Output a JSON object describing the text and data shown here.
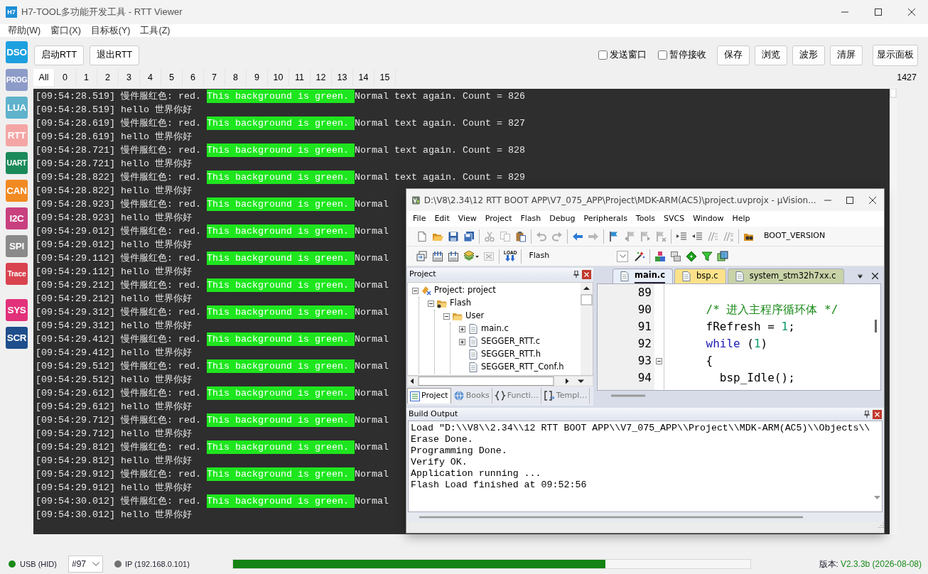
{
  "window": {
    "app_icon_text": "H7",
    "title": "H7-TOOL多功能开发工具 - RTT Viewer"
  },
  "menu": [
    "帮助(W)",
    "窗口(X)",
    "目标板(Y)",
    "工具(Z)"
  ],
  "sidebar": {
    "groups": [
      {
        "items": [
          {
            "label": "DSO",
            "color": "#1ea0e0"
          },
          {
            "label": "PROG",
            "color": "#8d9bc8"
          },
          {
            "label": "LUA",
            "color": "#5fb2cc"
          },
          {
            "label": "RTT",
            "color": "#f4a5a5"
          },
          {
            "label": "UART",
            "color": "#1b8a5a"
          },
          {
            "label": "CAN",
            "color": "#f28a22"
          },
          {
            "label": "I2C",
            "color": "#c8407f"
          },
          {
            "label": "SPI",
            "color": "#8a8a8a"
          },
          {
            "label": "Trace",
            "color": "#d9434f"
          }
        ]
      },
      {
        "items": [
          {
            "label": "SYS",
            "color": "#e2317b"
          },
          {
            "label": "SCR",
            "color": "#1f4e8c"
          }
        ]
      }
    ]
  },
  "toolbar": {
    "left_buttons": [
      "启动RTT",
      "退出RTT"
    ],
    "checkboxes": [
      {
        "label": "发送窗口",
        "checked": false
      },
      {
        "label": "暂停接收",
        "checked": false
      }
    ],
    "right_buttons": [
      "保存",
      "浏览",
      "波形",
      "清屏",
      "显示面板"
    ]
  },
  "channel_tabs": {
    "tabs": [
      {
        "label": "All",
        "selected": true
      },
      {
        "label": "0",
        "selected": false
      },
      {
        "label": "1",
        "selected": false
      },
      {
        "label": "2",
        "selected": false
      },
      {
        "label": "3",
        "selected": false
      },
      {
        "label": "4",
        "selected": false
      },
      {
        "label": "5",
        "selected": false
      },
      {
        "label": "6",
        "selected": false
      },
      {
        "label": "7",
        "selected": false
      },
      {
        "label": "8",
        "selected": false
      },
      {
        "label": "9",
        "selected": false
      },
      {
        "label": "10",
        "selected": false
      },
      {
        "label": "11",
        "selected": false
      },
      {
        "label": "12",
        "selected": false
      },
      {
        "label": "13",
        "selected": false
      },
      {
        "label": "14",
        "selected": false
      },
      {
        "label": "15",
        "selected": false
      }
    ],
    "count": "1427"
  },
  "terminal": {
    "lines": [
      {
        "kind": "color",
        "time": "[09:54:28.519]",
        "text": "慢件服红色: red.",
        "highlight": "This background is green.",
        "rest": "Normal text again. Count = 826"
      },
      {
        "kind": "plain",
        "time": "[09:54:28.519]",
        "text": "hello 世界你好"
      },
      {
        "kind": "color",
        "time": "[09:54:28.619]",
        "text": "慢件服红色: red.",
        "highlight": "This background is green.",
        "rest": "Normal text again. Count = 827"
      },
      {
        "kind": "plain",
        "time": "[09:54:28.619]",
        "text": "hello 世界你好"
      },
      {
        "kind": "color",
        "time": "[09:54:28.721]",
        "text": "慢件服红色: red.",
        "highlight": "This background is green.",
        "rest": "Normal text again. Count = 828"
      },
      {
        "kind": "plain",
        "time": "[09:54:28.721]",
        "text": "hello 世界你好"
      },
      {
        "kind": "color",
        "time": "[09:54:28.822]",
        "text": "慢件服红色: red.",
        "highlight": "This background is green.",
        "rest": "Normal text again. Count = 829"
      },
      {
        "kind": "plain",
        "time": "[09:54:28.822]",
        "text": "hello 世界你好"
      },
      {
        "kind": "color",
        "time": "[09:54:28.923]",
        "text": "慢件服红色: red.",
        "highlight": "This background is green.",
        "rest": "Normal"
      },
      {
        "kind": "plain",
        "time": "[09:54:28.923]",
        "text": "hello 世界你好"
      },
      {
        "kind": "color",
        "time": "[09:54:29.012]",
        "text": "慢件服红色: red.",
        "highlight": "This background is green.",
        "rest": "Normal"
      },
      {
        "kind": "plain",
        "time": "[09:54:29.012]",
        "text": "hello 世界你好"
      },
      {
        "kind": "color",
        "time": "[09:54:29.112]",
        "text": "慢件服红色: red.",
        "highlight": "This background is green.",
        "rest": "Normal"
      },
      {
        "kind": "plain",
        "time": "[09:54:29.112]",
        "text": "hello 世界你好"
      },
      {
        "kind": "color",
        "time": "[09:54:29.212]",
        "text": "慢件服红色: red.",
        "highlight": "This background is green.",
        "rest": "Normal"
      },
      {
        "kind": "plain",
        "time": "[09:54:29.212]",
        "text": "hello 世界你好"
      },
      {
        "kind": "color",
        "time": "[09:54:29.312]",
        "text": "慢件服红色: red.",
        "highlight": "This background is green.",
        "rest": "Normal"
      },
      {
        "kind": "plain",
        "time": "[09:54:29.312]",
        "text": "hello 世界你好"
      },
      {
        "kind": "color",
        "time": "[09:54:29.412]",
        "text": "慢件服红色: red.",
        "highlight": "This background is green.",
        "rest": "Normal"
      },
      {
        "kind": "plain",
        "time": "[09:54:29.412]",
        "text": "hello 世界你好"
      },
      {
        "kind": "color",
        "time": "[09:54:29.512]",
        "text": "慢件服红色: red.",
        "highlight": "This background is green.",
        "rest": "Normal"
      },
      {
        "kind": "plain",
        "time": "[09:54:29.512]",
        "text": "hello 世界你好"
      },
      {
        "kind": "color",
        "time": "[09:54:29.612]",
        "text": "慢件服红色: red.",
        "highlight": "This background is green.",
        "rest": "Normal"
      },
      {
        "kind": "plain",
        "time": "[09:54:29.612]",
        "text": "hello 世界你好"
      },
      {
        "kind": "color",
        "time": "[09:54:29.712]",
        "text": "慢件服红色: red.",
        "highlight": "This background is green.",
        "rest": "Normal"
      },
      {
        "kind": "plain",
        "time": "[09:54:29.712]",
        "text": "hello 世界你好"
      },
      {
        "kind": "color",
        "time": "[09:54:29.812]",
        "text": "慢件服红色: red.",
        "highlight": "This background is green.",
        "rest": "Normal"
      },
      {
        "kind": "plain",
        "time": "[09:54:29.812]",
        "text": "hello 世界你好"
      },
      {
        "kind": "color",
        "time": "[09:54:29.912]",
        "text": "慢件服红色: red.",
        "highlight": "This background is green.",
        "rest": "Normal"
      },
      {
        "kind": "plain",
        "time": "[09:54:29.912]",
        "text": "hello 世界你好"
      },
      {
        "kind": "color",
        "time": "[09:54:30.012]",
        "text": "慢件服红色: red.",
        "highlight": "This background is green.",
        "rest": "Normal"
      },
      {
        "kind": "plain",
        "time": "[09:54:30.012]",
        "text": "hello 世界你好"
      }
    ]
  },
  "status_bar": {
    "usb": {
      "label": "USB (HID)",
      "color": "#1a8a1a"
    },
    "device": "#97",
    "ip": {
      "label": "IP (192.168.0.101)",
      "color": "#707070"
    },
    "progress": {
      "level": 0.72
    },
    "version_label": "版本:",
    "version": "V2.3.3b (2026-08-08)"
  },
  "uvision": {
    "title": "D:\\V8\\2.34\\12 RTT BOOT APP\\V7_075_APP\\Project\\MDK-ARM(AC5)\\project.uvprojx - µVision...",
    "menu": [
      "File",
      "Edit",
      "View",
      "Project",
      "Flash",
      "Debug",
      "Peripherals",
      "Tools",
      "SVCS",
      "Window",
      "Help"
    ],
    "toolbar_1": {
      "groups": [
        {
          "items": [
            {
              "kind": "new",
              "disabled": false
            },
            {
              "kind": "open",
              "disabled": false
            },
            {
              "kind": "save",
              "disabled": false
            },
            {
              "kind": "saveall",
              "disabled": false
            }
          ]
        },
        {
          "items": [
            {
              "kind": "cut",
              "disabled": true
            },
            {
              "kind": "copy",
              "disabled": true
            },
            {
              "kind": "paste",
              "disabled": false
            }
          ]
        },
        {
          "items": [
            {
              "kind": "undo",
              "disabled": true
            },
            {
              "kind": "redo",
              "disabled": true
            }
          ]
        },
        {
          "items": [
            {
              "kind": "back",
              "disabled": false
            },
            {
              "kind": "forward",
              "disabled": true
            }
          ]
        },
        {
          "items": [
            {
              "kind": "flag",
              "disabled": false
            },
            {
              "kind": "flagprev",
              "disabled": true
            },
            {
              "kind": "flagnext",
              "disabled": true
            },
            {
              "kind": "flagclear",
              "disabled": true
            }
          ]
        },
        {
          "items": [
            {
              "kind": "indent",
              "disabled": false
            },
            {
              "kind": "unindent",
              "disabled": false
            },
            {
              "kind": "comment",
              "disabled": true
            },
            {
              "kind": "uncomment",
              "disabled": true
            }
          ]
        },
        {
          "items": [
            {
              "kind": "find",
              "disabled": false
            },
            {
              "kind": "findtext",
              "label": "BOOT_VERSION",
              "disabled": false
            }
          ]
        }
      ]
    },
    "toolbar_2": {
      "groups": [
        {
          "items": [
            {
              "kind": "translate",
              "disabled": false
            },
            {
              "kind": "build",
              "disabled": false
            },
            {
              "kind": "rebuild",
              "disabled": false
            },
            {
              "kind": "batch",
              "disabled": false
            },
            {
              "kind": "stop",
              "disabled": true
            }
          ]
        },
        {
          "items": [
            {
              "kind": "load",
              "label": "LOAD",
              "disabled": false
            }
          ]
        },
        {
          "items": [
            {
              "kind": "combo",
              "value": "Flash",
              "disabled": false
            },
            {
              "kind": "wand",
              "disabled": false
            }
          ]
        },
        {
          "items": [
            {
              "kind": "manage",
              "disabled": false
            },
            {
              "kind": "windows",
              "disabled": false
            },
            {
              "kind": "diamond",
              "disabled": false
            },
            {
              "kind": "funnel",
              "disabled": false
            },
            {
              "kind": "multi",
              "disabled": false
            }
          ]
        }
      ]
    },
    "project_pane": {
      "title": "Project",
      "tree": [
        {
          "label": "Project: project",
          "kind": "project",
          "expanded": true,
          "children": [
            {
              "label": "Flash",
              "kind": "target",
              "expanded": true,
              "children": [
                {
                  "label": "User",
                  "kind": "folder",
                  "expanded": true,
                  "children": [
                    {
                      "label": "main.c",
                      "kind": "file",
                      "expanded": false
                    },
                    {
                      "label": "SEGGER_RTT.c",
                      "kind": "file",
                      "expanded": false
                    },
                    {
                      "label": "SEGGER_RTT.h",
                      "kind": "file"
                    },
                    {
                      "label": "SEGGER_RTT_Conf.h",
                      "kind": "file"
                    }
                  ]
                }
              ]
            }
          ]
        }
      ],
      "tabs": [
        {
          "label": "Project",
          "kind": "project",
          "selected": true
        },
        {
          "label": "Books",
          "kind": "books",
          "selected": false
        },
        {
          "label": "Functi…",
          "kind": "functions",
          "selected": false
        },
        {
          "label": "Templ…",
          "kind": "templates",
          "selected": false
        }
      ]
    },
    "editor": {
      "tabs": [
        {
          "label": "main.c",
          "selected": true,
          "color": "#e8eef8"
        },
        {
          "label": "bsp.c",
          "selected": false,
          "color": "#fbe28a"
        },
        {
          "label": "system_stm32h7xx.c",
          "selected": false,
          "color": "#c9d3a8"
        }
      ],
      "lines": [
        {
          "number": "89",
          "fold_marker": false
        },
        {
          "number": "90",
          "fold_marker": false,
          "tokens": [
            {
              "kind": "comment",
              "text": "    /* 进入主程序循环体 */"
            }
          ]
        },
        {
          "number": "91",
          "fold_marker": false,
          "tokens": [
            {
              "kind": "plain",
              "text": "    fRefresh = "
            },
            {
              "kind": "number",
              "text": "1"
            },
            {
              "kind": "plain",
              "text": ";"
            }
          ]
        },
        {
          "number": "92",
          "fold_marker": false,
          "tokens": [
            {
              "kind": "keyword",
              "text": "    while"
            },
            {
              "kind": "plain",
              "text": " ("
            },
            {
              "kind": "number",
              "text": "1"
            },
            {
              "kind": "plain",
              "text": ")"
            }
          ]
        },
        {
          "number": "93",
          "fold_marker": true,
          "tokens": [
            {
              "kind": "plain",
              "text": "    {"
            }
          ]
        },
        {
          "number": "94",
          "fold_marker": false,
          "tokens": [
            {
              "kind": "plain",
              "text": "      bsp_Idle();"
            }
          ]
        }
      ]
    },
    "build_output": {
      "title": "Build Output",
      "lines": [
        "Load \"D:\\\\V8\\\\2.34\\\\12 RTT BOOT APP\\\\V7_075_APP\\\\Project\\\\MDK-ARM(AC5)\\\\Objects\\\\",
        "Erase Done.",
        "Programming Done.",
        "Verify OK.",
        "Application running ...",
        "Flash Load finished at 09:52:56"
      ]
    }
  }
}
